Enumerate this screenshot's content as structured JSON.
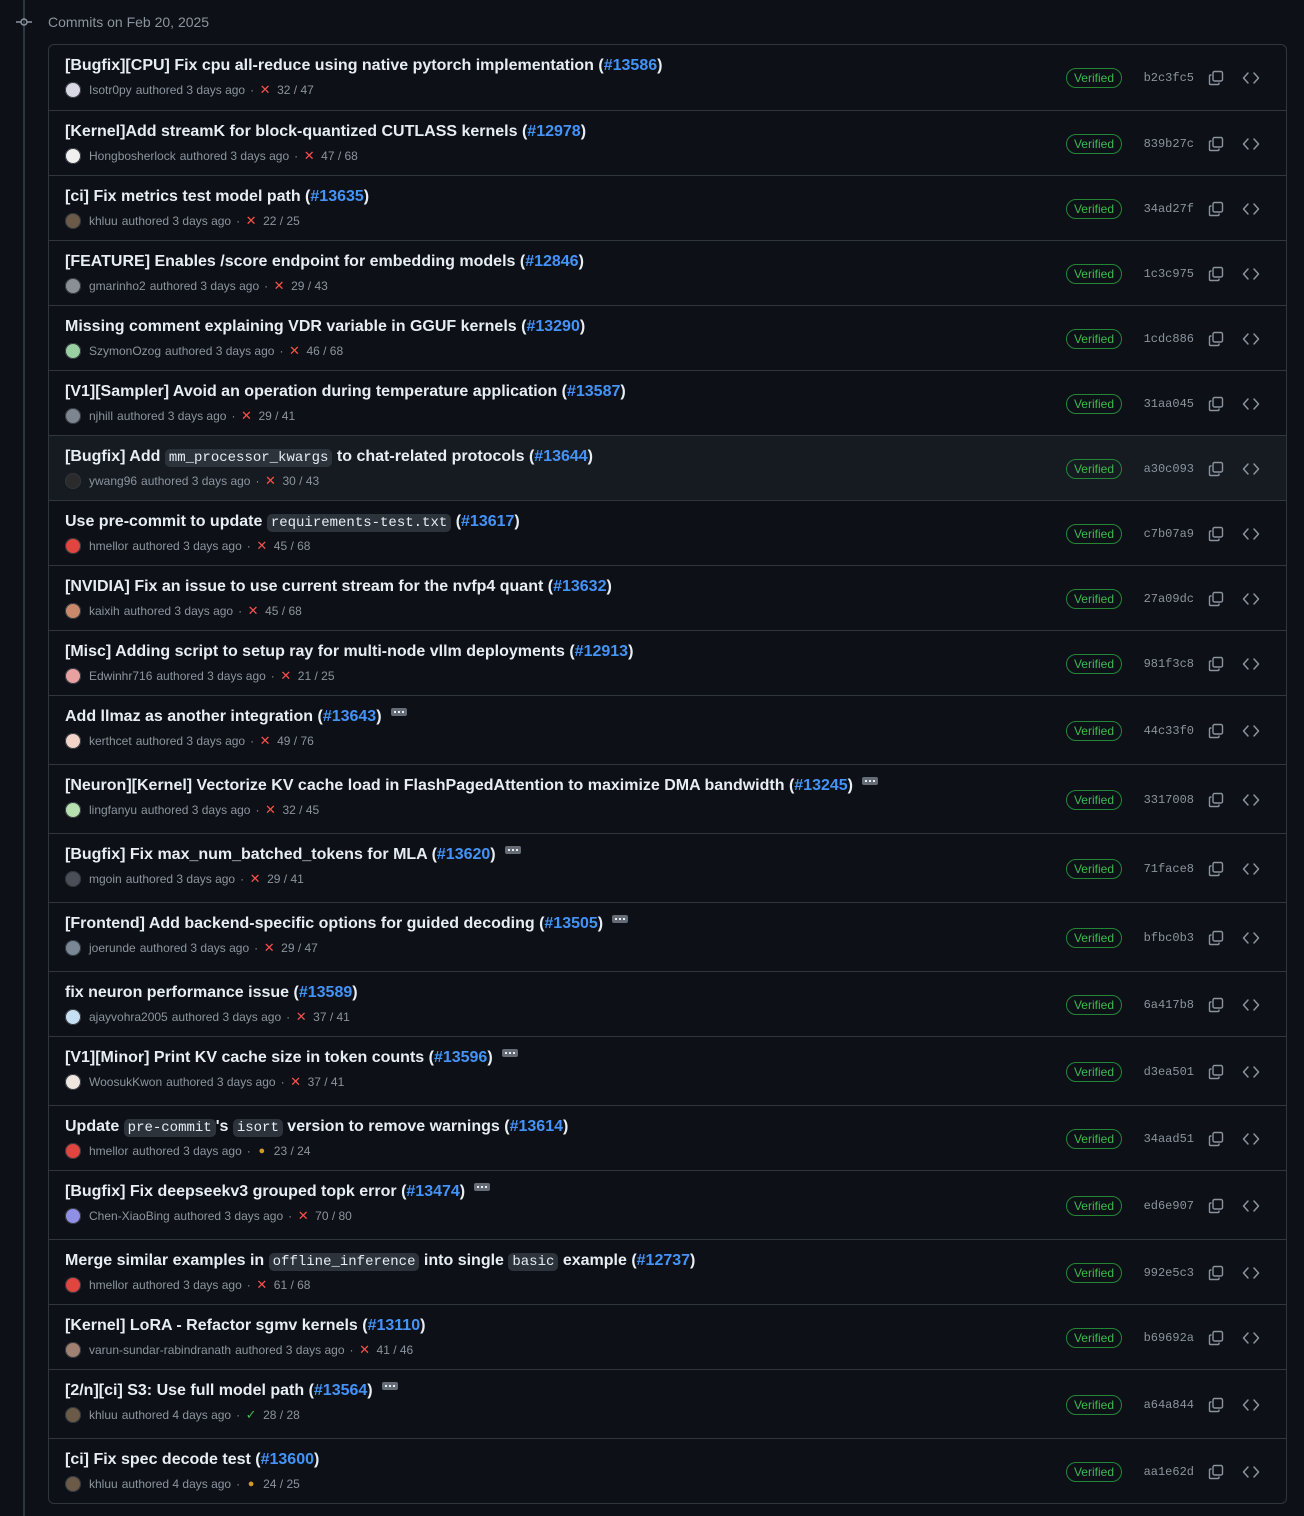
{
  "group": {
    "title": "Commits on Feb 20, 2025"
  },
  "verified_label": "Verified",
  "colors": {
    "link": "#4493f8",
    "fail": "#f85149",
    "success": "#3fb950",
    "pending": "#d29922",
    "verified_border": "#238636"
  },
  "commits": [
    {
      "parts": [
        {
          "t": "text",
          "v": "[Bugfix][CPU] Fix cpu all-reduce using native pytorch implementation ("
        },
        {
          "t": "pr",
          "v": "#13586"
        },
        {
          "t": "text",
          "v": ")"
        }
      ],
      "author": "Isotr0py",
      "when": "authored 3 days ago",
      "status": "fail",
      "checks": "32 / 47",
      "sha": "b2c3fc5",
      "avatar": "#d9d9e6",
      "more": false
    },
    {
      "parts": [
        {
          "t": "text",
          "v": "[Kernel]Add streamK for block-quantized CUTLASS kernels ("
        },
        {
          "t": "pr",
          "v": "#12978"
        },
        {
          "t": "text",
          "v": ")"
        }
      ],
      "author": "Hongbosherlock",
      "when": "authored 3 days ago",
      "status": "fail",
      "checks": "47 / 68",
      "sha": "839b27c",
      "avatar": "#f0f0f0",
      "more": false
    },
    {
      "parts": [
        {
          "t": "text",
          "v": "[ci] Fix metrics test model path ("
        },
        {
          "t": "pr",
          "v": "#13635"
        },
        {
          "t": "text",
          "v": ")"
        }
      ],
      "author": "khluu",
      "when": "authored 3 days ago",
      "status": "fail",
      "checks": "22 / 25",
      "sha": "34ad27f",
      "avatar": "#6b5a48",
      "more": false
    },
    {
      "parts": [
        {
          "t": "text",
          "v": "[FEATURE] Enables /score endpoint for embedding models ("
        },
        {
          "t": "pr",
          "v": "#12846"
        },
        {
          "t": "text",
          "v": ")"
        }
      ],
      "author": "gmarinho2",
      "when": "authored 3 days ago",
      "status": "fail",
      "checks": "29 / 43",
      "sha": "1c3c975",
      "avatar": "#8a8f96",
      "more": false
    },
    {
      "parts": [
        {
          "t": "text",
          "v": "Missing comment explaining VDR variable in GGUF kernels ("
        },
        {
          "t": "pr",
          "v": "#13290"
        },
        {
          "t": "text",
          "v": ")"
        }
      ],
      "author": "SzymonOzog",
      "when": "authored 3 days ago",
      "status": "fail",
      "checks": "46 / 68",
      "sha": "1cdc886",
      "avatar": "#9ad1a3",
      "more": false
    },
    {
      "parts": [
        {
          "t": "text",
          "v": "[V1][Sampler] Avoid an operation during temperature application ("
        },
        {
          "t": "pr",
          "v": "#13587"
        },
        {
          "t": "text",
          "v": ")"
        }
      ],
      "author": "njhill",
      "when": "authored 3 days ago",
      "status": "fail",
      "checks": "29 / 41",
      "sha": "31aa045",
      "avatar": "#7d8590",
      "more": false
    },
    {
      "parts": [
        {
          "t": "text",
          "v": "[Bugfix] Add "
        },
        {
          "t": "code",
          "v": "mm_processor_kwargs"
        },
        {
          "t": "text",
          "v": " to chat-related protocols ("
        },
        {
          "t": "pr",
          "v": "#13644"
        },
        {
          "t": "text",
          "v": ")"
        }
      ],
      "author": "ywang96",
      "when": "authored 3 days ago",
      "status": "fail",
      "checks": "30 / 43",
      "sha": "a30c093",
      "avatar": "#2b2b2b",
      "more": false,
      "highlight": true
    },
    {
      "parts": [
        {
          "t": "text",
          "v": "Use pre-commit to update "
        },
        {
          "t": "code",
          "v": "requirements-test.txt"
        },
        {
          "t": "text",
          "v": " ("
        },
        {
          "t": "pr",
          "v": "#13617"
        },
        {
          "t": "text",
          "v": ")"
        }
      ],
      "author": "hmellor",
      "when": "authored 3 days ago",
      "status": "fail",
      "checks": "45 / 68",
      "sha": "c7b07a9",
      "avatar": "#e0453f",
      "more": false
    },
    {
      "parts": [
        {
          "t": "text",
          "v": "[NVIDIA] Fix an issue to use current stream for the nvfp4 quant ("
        },
        {
          "t": "pr",
          "v": "#13632"
        },
        {
          "t": "text",
          "v": ")"
        }
      ],
      "author": "kaixih",
      "when": "authored 3 days ago",
      "status": "fail",
      "checks": "45 / 68",
      "sha": "27a09dc",
      "avatar": "#c98a6b",
      "more": false
    },
    {
      "parts": [
        {
          "t": "text",
          "v": "[Misc] Adding script to setup ray for multi-node vllm deployments ("
        },
        {
          "t": "pr",
          "v": "#12913"
        },
        {
          "t": "text",
          "v": ")"
        }
      ],
      "author": "Edwinhr716",
      "when": "authored 3 days ago",
      "status": "fail",
      "checks": "21 / 25",
      "sha": "981f3c8",
      "avatar": "#e8a0a0",
      "more": false
    },
    {
      "parts": [
        {
          "t": "text",
          "v": "Add llmaz as another integration ("
        },
        {
          "t": "pr",
          "v": "#13643"
        },
        {
          "t": "text",
          "v": ")"
        }
      ],
      "author": "kerthcet",
      "when": "authored 3 days ago",
      "status": "fail",
      "checks": "49 / 76",
      "sha": "44c33f0",
      "avatar": "#f2d4c9",
      "more": true
    },
    {
      "parts": [
        {
          "t": "text",
          "v": "[Neuron][Kernel] Vectorize KV cache load in FlashPagedAttention to maximize DMA bandwidth ("
        },
        {
          "t": "pr",
          "v": "#13245"
        },
        {
          "t": "text",
          "v": ")"
        }
      ],
      "author": "lingfanyu",
      "when": "authored 3 days ago",
      "status": "fail",
      "checks": "32 / 45",
      "sha": "3317008",
      "avatar": "#b6e0b0",
      "more": true
    },
    {
      "parts": [
        {
          "t": "text",
          "v": "[Bugfix] Fix max_num_batched_tokens for MLA ("
        },
        {
          "t": "pr",
          "v": "#13620"
        },
        {
          "t": "text",
          "v": ")"
        }
      ],
      "author": "mgoin",
      "when": "authored 3 days ago",
      "status": "fail",
      "checks": "29 / 41",
      "sha": "71face8",
      "avatar": "#4a4f57",
      "more": true
    },
    {
      "parts": [
        {
          "t": "text",
          "v": "[Frontend] Add backend-specific options for guided decoding ("
        },
        {
          "t": "pr",
          "v": "#13505"
        },
        {
          "t": "text",
          "v": ")"
        }
      ],
      "author": "joerunde",
      "when": "authored 3 days ago",
      "status": "fail",
      "checks": "29 / 47",
      "sha": "bfbc0b3",
      "avatar": "#7a8794",
      "more": true
    },
    {
      "parts": [
        {
          "t": "text",
          "v": "fix neuron performance issue ("
        },
        {
          "t": "pr",
          "v": "#13589"
        },
        {
          "t": "text",
          "v": ")"
        }
      ],
      "author": "ajayvohra2005",
      "when": "authored 3 days ago",
      "status": "fail",
      "checks": "37 / 41",
      "sha": "6a417b8",
      "avatar": "#c7dff2",
      "more": false
    },
    {
      "parts": [
        {
          "t": "text",
          "v": "[V1][Minor] Print KV cache size in token counts ("
        },
        {
          "t": "pr",
          "v": "#13596"
        },
        {
          "t": "text",
          "v": ")"
        }
      ],
      "author": "WoosukKwon",
      "when": "authored 3 days ago",
      "status": "fail",
      "checks": "37 / 41",
      "sha": "d3ea501",
      "avatar": "#f0e6e0",
      "more": true
    },
    {
      "parts": [
        {
          "t": "text",
          "v": "Update "
        },
        {
          "t": "code",
          "v": "pre-commit"
        },
        {
          "t": "text",
          "v": "'s "
        },
        {
          "t": "code",
          "v": "isort"
        },
        {
          "t": "text",
          "v": " version to remove warnings ("
        },
        {
          "t": "pr",
          "v": "#13614"
        },
        {
          "t": "text",
          "v": ")"
        }
      ],
      "author": "hmellor",
      "when": "authored 3 days ago",
      "status": "pending",
      "checks": "23 / 24",
      "sha": "34aad51",
      "avatar": "#e0453f",
      "more": false
    },
    {
      "parts": [
        {
          "t": "text",
          "v": "[Bugfix] Fix deepseekv3 grouped topk error ("
        },
        {
          "t": "pr",
          "v": "#13474"
        },
        {
          "t": "text",
          "v": ")"
        }
      ],
      "author": "Chen-XiaoBing",
      "when": "authored 3 days ago",
      "status": "fail",
      "checks": "70 / 80",
      "sha": "ed6e907",
      "avatar": "#8f8fe6",
      "more": true
    },
    {
      "parts": [
        {
          "t": "text",
          "v": "Merge similar examples in "
        },
        {
          "t": "code",
          "v": "offline_inference"
        },
        {
          "t": "text",
          "v": " into single "
        },
        {
          "t": "code",
          "v": "basic"
        },
        {
          "t": "text",
          "v": " example ("
        },
        {
          "t": "pr",
          "v": "#12737"
        },
        {
          "t": "text",
          "v": ")"
        }
      ],
      "author": "hmellor",
      "when": "authored 3 days ago",
      "status": "fail",
      "checks": "61 / 68",
      "sha": "992e5c3",
      "avatar": "#e0453f",
      "more": false
    },
    {
      "parts": [
        {
          "t": "text",
          "v": "[Kernel] LoRA - Refactor sgmv kernels ("
        },
        {
          "t": "pr",
          "v": "#13110"
        },
        {
          "t": "text",
          "v": ")"
        }
      ],
      "author": "varun-sundar-rabindranath",
      "when": "authored 3 days ago",
      "status": "fail",
      "checks": "41 / 46",
      "sha": "b69692a",
      "avatar": "#a08070",
      "more": false
    },
    {
      "parts": [
        {
          "t": "text",
          "v": "[2/n][ci] S3: Use full model path ("
        },
        {
          "t": "pr",
          "v": "#13564"
        },
        {
          "t": "text",
          "v": ")"
        }
      ],
      "author": "khluu",
      "when": "authored 4 days ago",
      "status": "success",
      "checks": "28 / 28",
      "sha": "a64a844",
      "avatar": "#6b5a48",
      "more": true
    },
    {
      "parts": [
        {
          "t": "text",
          "v": "[ci] Fix spec decode test ("
        },
        {
          "t": "pr",
          "v": "#13600"
        },
        {
          "t": "text",
          "v": ")"
        }
      ],
      "author": "khluu",
      "when": "authored 4 days ago",
      "status": "pending",
      "checks": "24 / 25",
      "sha": "aa1e62d",
      "avatar": "#6b5a48",
      "more": false
    }
  ]
}
